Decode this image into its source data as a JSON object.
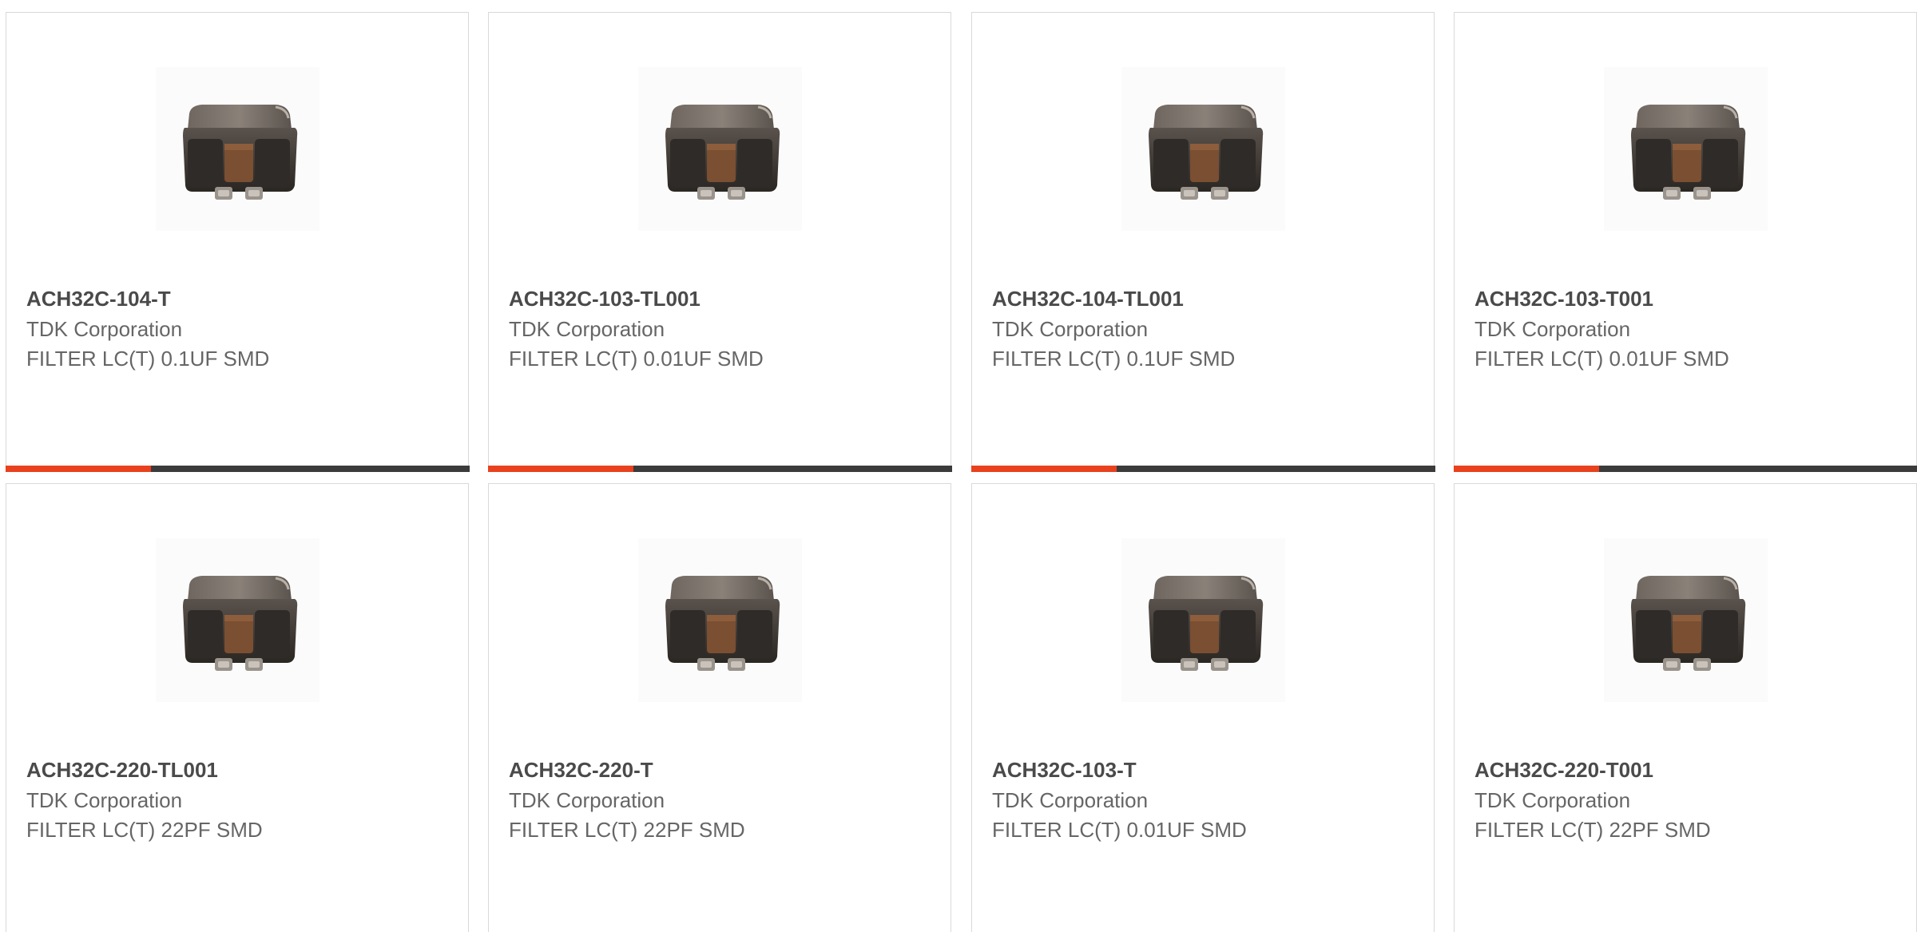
{
  "products": [
    {
      "part_number": "ACH32C-104-T",
      "manufacturer": "TDK Corporation",
      "description": "FILTER LC(T) 0.1UF SMD",
      "image": "lc-filter-chip-photo"
    },
    {
      "part_number": "ACH32C-103-TL001",
      "manufacturer": "TDK Corporation",
      "description": "FILTER LC(T) 0.01UF SMD",
      "image": "lc-filter-chip-photo"
    },
    {
      "part_number": "ACH32C-104-TL001",
      "manufacturer": "TDK Corporation",
      "description": "FILTER LC(T) 0.1UF SMD",
      "image": "lc-filter-chip-photo"
    },
    {
      "part_number": "ACH32C-103-T001",
      "manufacturer": "TDK Corporation",
      "description": "FILTER LC(T) 0.01UF SMD",
      "image": "lc-filter-chip-photo"
    },
    {
      "part_number": "ACH32C-220-TL001",
      "manufacturer": "TDK Corporation",
      "description": "FILTER LC(T) 22PF SMD",
      "image": "lc-filter-chip-photo"
    },
    {
      "part_number": "ACH32C-220-T",
      "manufacturer": "TDK Corporation",
      "description": "FILTER LC(T) 22PF SMD",
      "image": "lc-filter-chip-photo"
    },
    {
      "part_number": "ACH32C-103-T",
      "manufacturer": "TDK Corporation",
      "description": "FILTER LC(T) 0.01UF SMD",
      "image": "lc-filter-chip-photo"
    },
    {
      "part_number": "ACH32C-220-T001",
      "manufacturer": "TDK Corporation",
      "description": "FILTER LC(T) 22PF SMD",
      "image": "lc-filter-chip-photo"
    }
  ],
  "colors": {
    "accent": "#e8411e",
    "bar_dark": "#3b3b3b",
    "card_border": "#d9d9d9",
    "title_text": "#4a4a4a",
    "body_text": "#666666"
  }
}
